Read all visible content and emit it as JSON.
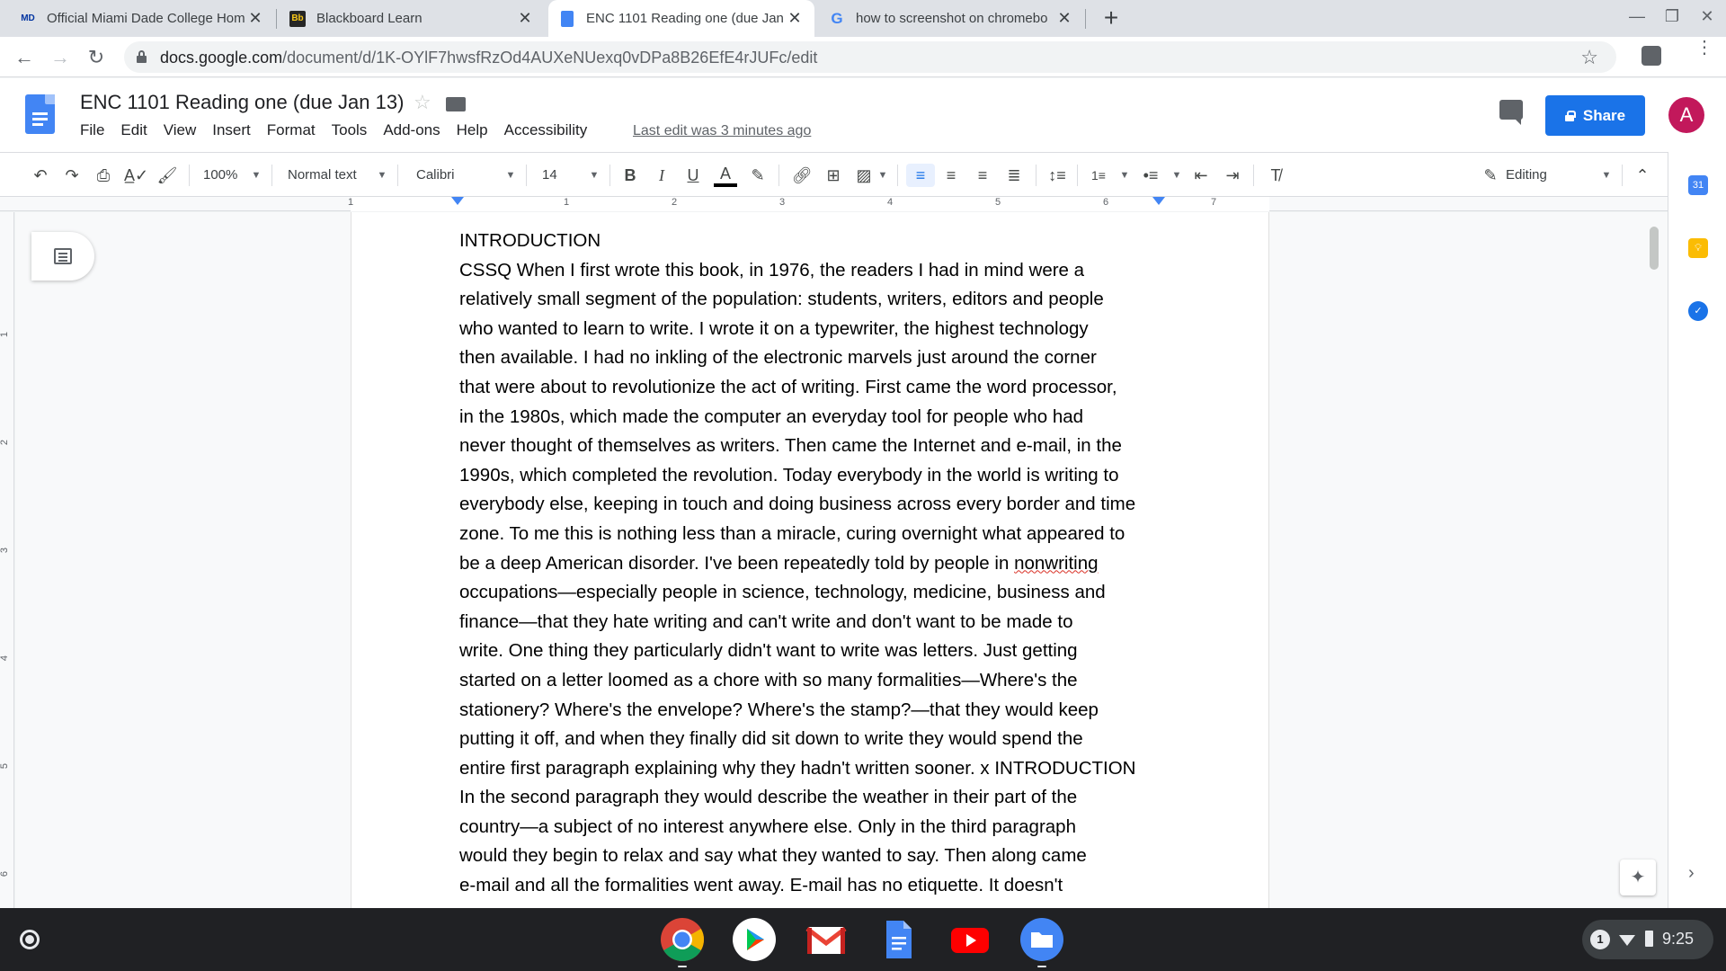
{
  "browser": {
    "tabs": [
      {
        "title": "Official Miami Dade College Hom",
        "favicon": "mdc-logo"
      },
      {
        "title": "Blackboard Learn",
        "favicon": "blackboard-logo"
      },
      {
        "title": "ENC 1101 Reading one (due Jan",
        "favicon": "docs-logo"
      },
      {
        "title": "how to screenshot on chromebo",
        "favicon": "google-logo"
      }
    ],
    "url_domain": "docs.google.com",
    "url_path": "/document/d/1K-OYlF7hwsfRzOd4AUXeNUexq0vDPa8B26EfE4rJUFc/edit"
  },
  "doc": {
    "title": "ENC 1101 Reading one (due Jan 13)",
    "menu": [
      "File",
      "Edit",
      "View",
      "Insert",
      "Format",
      "Tools",
      "Add-ons",
      "Help",
      "Accessibility"
    ],
    "last_edit": "Last edit was 3 minutes ago",
    "share_label": "Share",
    "avatar_initial": "A"
  },
  "toolbar": {
    "zoom": "100%",
    "style": "Normal text",
    "font": "Calibri",
    "font_size": "14",
    "mode": "Editing"
  },
  "ruler": {
    "numbers": [
      "1",
      "1",
      "2",
      "3",
      "4",
      "5",
      "6",
      "7"
    ],
    "vertical_numbers": [
      "1",
      "2",
      "3",
      "4",
      "5",
      "6"
    ]
  },
  "body": {
    "lines": [
      "INTRODUCTION",
      "CSSQ When I first wrote this book, in 1976, the readers I had in mind were a",
      "relatively small segment of the population: students, writers, editors and people",
      "who wanted to learn to write. I wrote it on a typewriter, the highest technology",
      "then available. I had no inkling of the electronic marvels just around the corner",
      "that were about to revolutionize the act of writing. First came the word processor,",
      "in the 1980s, which made the computer an everyday tool for people who had",
      "never thought of themselves as writers. Then came the Internet and e-mail, in the",
      "1990s, which completed the revolution. Today everybody in the world is writing to",
      "everybody else, keeping in touch and doing business across every border and time",
      "zone. To me this is nothing less than a miracle, curing overnight what appeared to",
      "be a deep American disorder. I've been repeatedly told by people in ",
      "occupations—especially people in science, technology, medicine, business and",
      "finance—that they hate writing and can't write and don't want to be made to",
      "write. One thing they particularly didn't want to write was letters. Just getting",
      "started on a letter loomed as a chore with so many formalities—Where's the",
      "stationery? Where's the envelope? Where's the stamp?—that they would keep",
      "putting it off, and when they finally did sit down to write they would spend the",
      "entire first paragraph explaining why they hadn't written sooner. x INTRODUCTION",
      "In the second paragraph they would describe the weather in their part of the",
      "country—a subject of no interest anywhere else. Only in the third paragraph",
      "would they begin to relax and say what they wanted to say. Then along came",
      "e-mail and all the formalities went away. E-mail has no etiquette. It doesn't"
    ],
    "misspelled": "nonwriting"
  },
  "shelf": {
    "apps": [
      "chrome",
      "play-store",
      "gmail",
      "docs",
      "youtube",
      "files"
    ],
    "notification_count": "1",
    "time": "9:25"
  },
  "colors": {
    "accent": "#1a73e8",
    "avatar": "#c2185b",
    "docs_blue": "#4285f4"
  }
}
